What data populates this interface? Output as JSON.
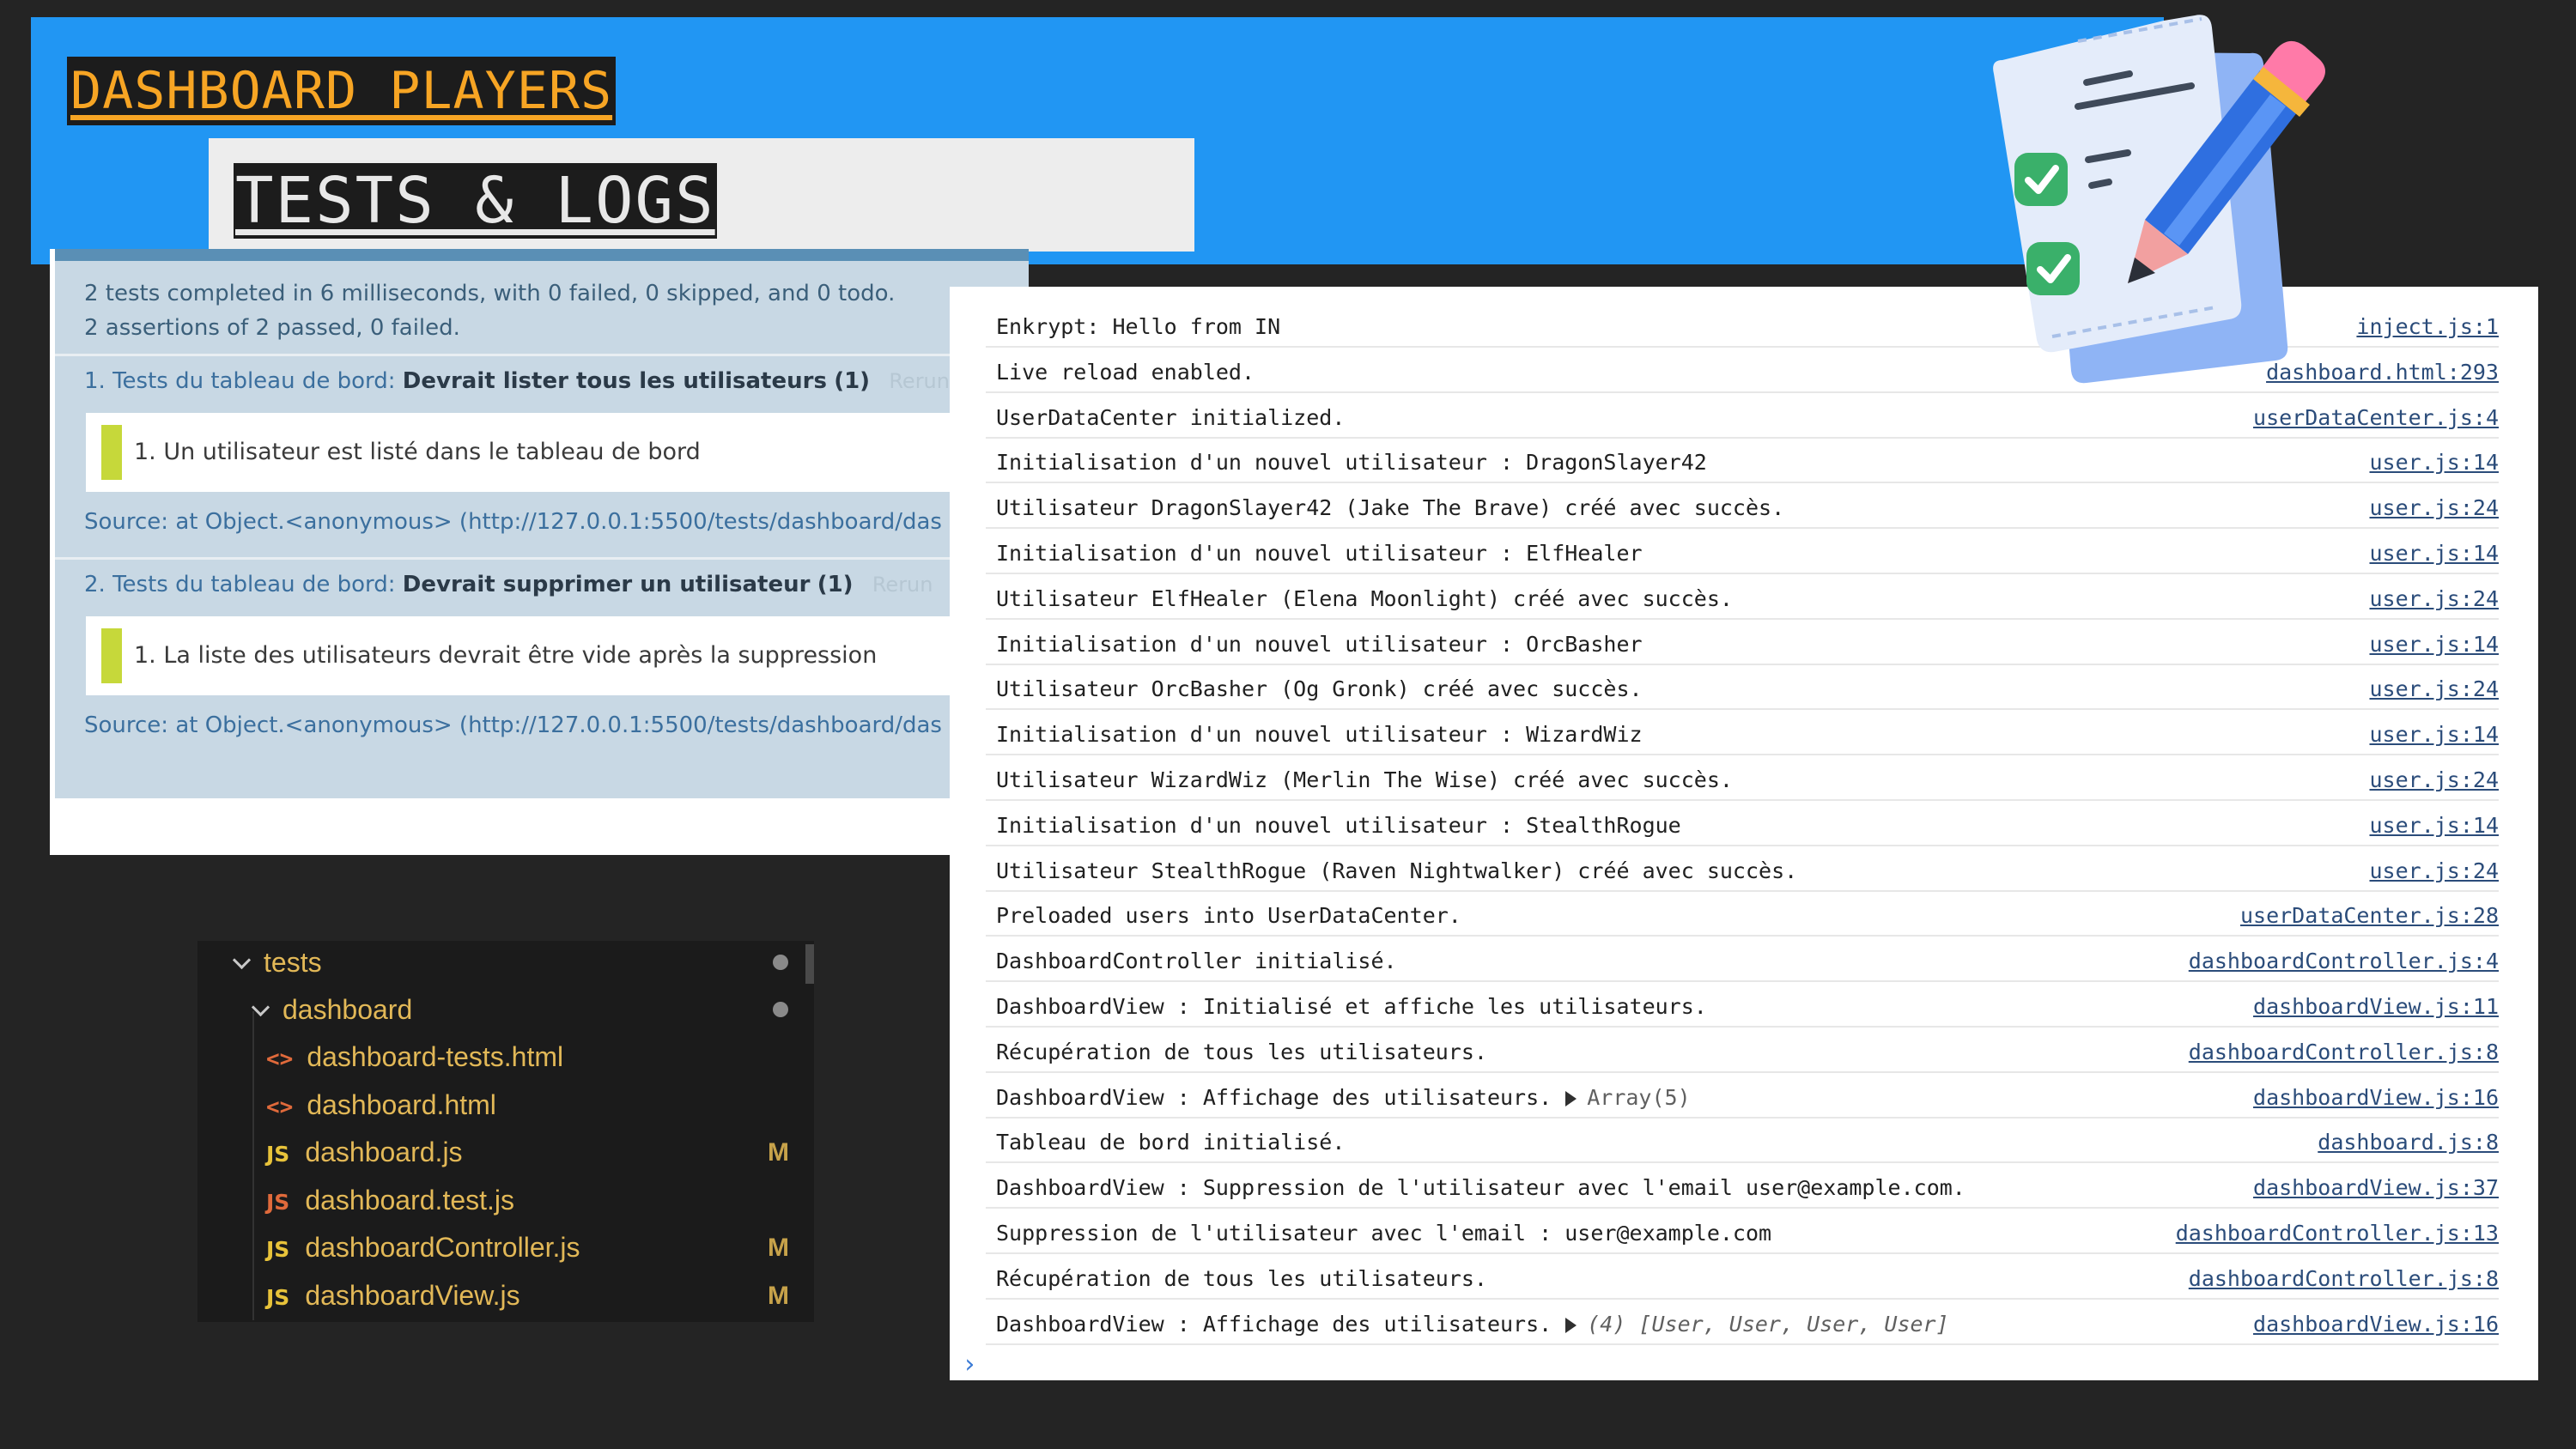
{
  "header": {
    "title": "DASHBOARD PLAYERS",
    "subtitle": "TESTS & LOGS"
  },
  "qunit": {
    "summary_line1": "2 tests completed in 6 milliseconds, with 0 failed, 0 skipped, and 0 todo.",
    "summary_line2": "2 assertions of 2 passed, 0 failed.",
    "tests": [
      {
        "module": "1. Tests du tableau de bord:",
        "name": "Devrait lister tous les utilisateurs",
        "count": "(1)",
        "rerun": "Rerun",
        "assertion": "1. Un utilisateur est listé dans le tableau de bord",
        "source": "Source: at Object.<anonymous> (http://127.0.0.1:5500/tests/dashboard/das"
      },
      {
        "module": "2. Tests du tableau de bord:",
        "name": "Devrait supprimer un utilisateur",
        "count": "(1)",
        "rerun": "Rerun",
        "assertion": "1. La liste des utilisateurs devrait être vide après la suppression",
        "source": "Source: at Object.<anonymous> (http://127.0.0.1:5500/tests/dashboard/das"
      }
    ]
  },
  "console": {
    "rows": [
      {
        "msg": "Enkrypt: Hello from IN",
        "src": "inject.js:1"
      },
      {
        "msg": "Live reload enabled.",
        "src": "dashboard.html:293"
      },
      {
        "msg": "UserDataCenter initialized.",
        "src": "userDataCenter.js:4"
      },
      {
        "msg": "Initialisation d'un nouvel utilisateur : DragonSlayer42",
        "src": "user.js:14"
      },
      {
        "msg": "Utilisateur DragonSlayer42 (Jake The Brave) créé avec succès.",
        "src": "user.js:24"
      },
      {
        "msg": "Initialisation d'un nouvel utilisateur : ElfHealer",
        "src": "user.js:14"
      },
      {
        "msg": "Utilisateur ElfHealer (Elena Moonlight) créé avec succès.",
        "src": "user.js:24"
      },
      {
        "msg": "Initialisation d'un nouvel utilisateur : OrcBasher",
        "src": "user.js:14"
      },
      {
        "msg": "Utilisateur OrcBasher (Og Gronk) créé avec succès.",
        "src": "user.js:24"
      },
      {
        "msg": "Initialisation d'un nouvel utilisateur : WizardWiz",
        "src": "user.js:14"
      },
      {
        "msg": "Utilisateur WizardWiz (Merlin The Wise) créé avec succès.",
        "src": "user.js:24"
      },
      {
        "msg": "Initialisation d'un nouvel utilisateur : StealthRogue",
        "src": "user.js:14"
      },
      {
        "msg": "Utilisateur StealthRogue (Raven Nightwalker) créé avec succès.",
        "src": "user.js:24"
      },
      {
        "msg": "Preloaded users into UserDataCenter.",
        "src": "userDataCenter.js:28"
      },
      {
        "msg": "DashboardController initialisé.",
        "src": "dashboardController.js:4"
      },
      {
        "msg": "DashboardView : Initialisé et affiche les utilisateurs.",
        "src": "dashboardView.js:11"
      },
      {
        "msg": "Récupération de tous les utilisateurs.",
        "src": "dashboardController.js:8"
      },
      {
        "msg": "DashboardView : Affichage des utilisateurs.",
        "obj": "Array(5)",
        "src": "dashboardView.js:16"
      },
      {
        "msg": "Tableau de bord initialisé.",
        "src": "dashboard.js:8"
      },
      {
        "msg": "DashboardView : Suppression de l'utilisateur avec l'email user@example.com.",
        "src": "dashboardView.js:37"
      },
      {
        "msg": "Suppression de l'utilisateur avec l'email : user@example.com",
        "src": "dashboardController.js:13"
      },
      {
        "msg": "Récupération de tous les utilisateurs.",
        "src": "dashboardController.js:8"
      },
      {
        "msg": "DashboardView : Affichage des utilisateurs.",
        "obj": "(4) [User, User, User, User]",
        "src": "dashboardView.js:16"
      }
    ],
    "prompt": "›"
  },
  "explorer": {
    "folders": [
      {
        "label": "tests",
        "modified_dot": true
      },
      {
        "label": "dashboard",
        "modified_dot": true
      }
    ],
    "files": [
      {
        "label": "dashboard-tests.html",
        "icon": "html-icon",
        "icon_glyph": "<>",
        "flag": ""
      },
      {
        "label": "dashboard.html",
        "icon": "html-icon",
        "icon_glyph": "<>",
        "flag": ""
      },
      {
        "label": "dashboard.js",
        "icon": "js-icon",
        "icon_glyph": "JS",
        "flag": "M"
      },
      {
        "label": "dashboard.test.js",
        "icon": "js-test-icon",
        "icon_glyph": "JS",
        "flag": ""
      },
      {
        "label": "dashboardController.js",
        "icon": "js-icon",
        "icon_glyph": "JS",
        "flag": "M"
      },
      {
        "label": "dashboardView.js",
        "icon": "js-icon",
        "icon_glyph": "JS",
        "flag": "M"
      }
    ]
  },
  "colors": {
    "banner": "#2196f3",
    "title_accent": "#f7a524",
    "link": "#2b4c7a",
    "assert_pass": "#c6d83a",
    "folder_text": "#e2b857"
  }
}
